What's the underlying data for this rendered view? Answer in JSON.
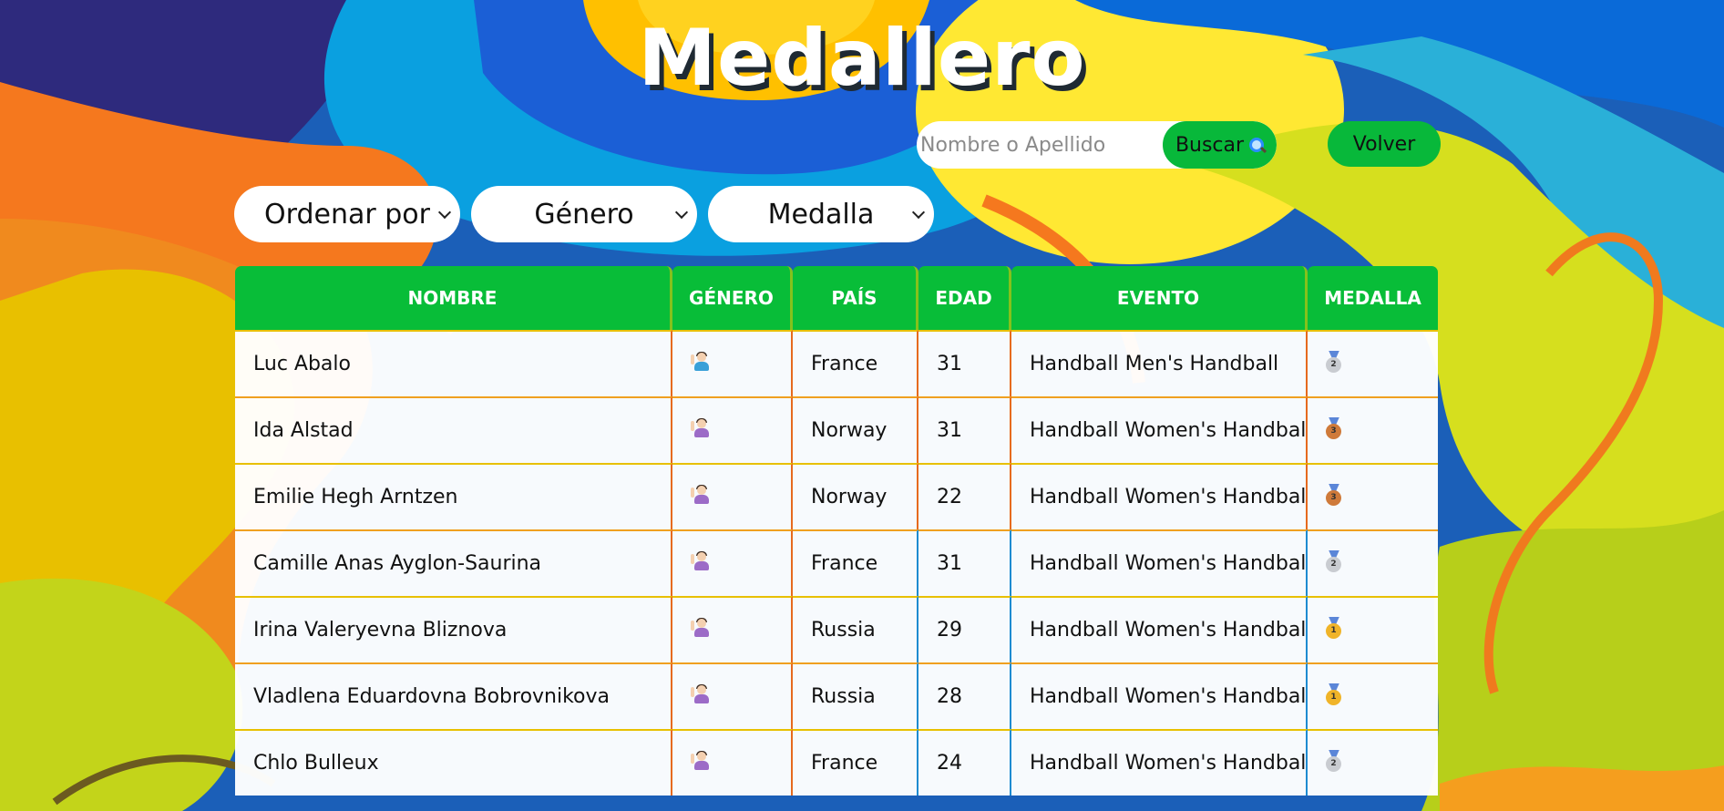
{
  "page": {
    "title": "Medallero"
  },
  "search": {
    "placeholder": "Nombre o Apellido",
    "button_label": "Buscar",
    "button_icon": "magnifying-glass-icon"
  },
  "nav": {
    "back_label": "Volver"
  },
  "filters": {
    "order": {
      "selected": "Ordenar por"
    },
    "gender": {
      "selected": "Género"
    },
    "medal": {
      "selected": "Medalla"
    }
  },
  "table": {
    "columns": [
      "NOMBRE",
      "GÉNERO",
      "PAÍS",
      "EDAD",
      "EVENTO",
      "MEDALLA"
    ],
    "rows": [
      {
        "name": "Luc Abalo",
        "gender": "male",
        "country": "France",
        "age": "31",
        "event": "Handball Men's Handball",
        "medal": "silver",
        "medal_number": "2"
      },
      {
        "name": "Ida Alstad",
        "gender": "female",
        "country": "Norway",
        "age": "31",
        "event": "Handball Women's Handball",
        "medal": "bronze",
        "medal_number": "3"
      },
      {
        "name": "Emilie Hegh Arntzen",
        "gender": "female",
        "country": "Norway",
        "age": "22",
        "event": "Handball Women's Handball",
        "medal": "bronze",
        "medal_number": "3"
      },
      {
        "name": "Camille Anas Ayglon-Saurina",
        "gender": "female",
        "country": "France",
        "age": "31",
        "event": "Handball Women's Handball",
        "medal": "silver",
        "medal_number": "2"
      },
      {
        "name": "Irina Valeryevna Bliznova",
        "gender": "female",
        "country": "Russia",
        "age": "29",
        "event": "Handball Women's Handball",
        "medal": "gold",
        "medal_number": "1"
      },
      {
        "name": "Vladlena Eduardovna Bobrovnikova",
        "gender": "female",
        "country": "Russia",
        "age": "28",
        "event": "Handball Women's Handball",
        "medal": "gold",
        "medal_number": "1"
      },
      {
        "name": "Chlo Bulleux",
        "gender": "female",
        "country": "France",
        "age": "24",
        "event": "Handball Women's Handball",
        "medal": "silver",
        "medal_number": "2"
      }
    ]
  },
  "colors": {
    "accent_green": "#08bd38",
    "bg_blue": "#1b5fb8",
    "bg_yellow": "#ffd21f",
    "bg_orange": "#f5781e",
    "bg_lime": "#c6d61e"
  }
}
